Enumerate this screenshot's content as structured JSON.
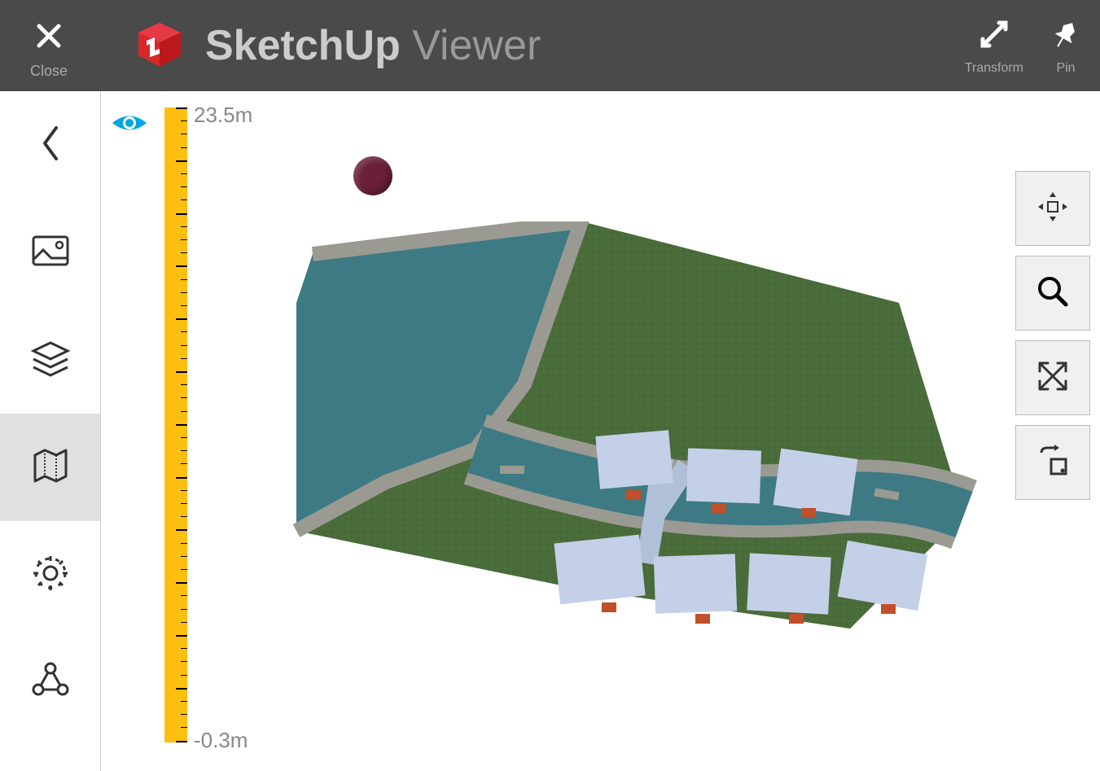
{
  "header": {
    "close_label": "Close",
    "app_name_bold": "SketchUp",
    "app_name_light": "Viewer",
    "transform_label": "Transform",
    "pin_label": "Pin"
  },
  "ruler": {
    "top_value": "23.5m",
    "bottom_value": "-0.3m"
  },
  "sidebar": {
    "active_index": 3
  },
  "icons": {
    "back": "chevron-left",
    "image": "image-icon",
    "layers": "layers-icon",
    "map": "map-icon",
    "settings": "gear-icon",
    "share": "share-nodes-icon"
  },
  "tools": {
    "move": "move-icon",
    "zoom": "search-icon",
    "fit": "expand-icon",
    "rotate": "rotate-icon"
  },
  "colors": {
    "header_bg": "#4a4a4a",
    "ruler": "#fdbf0f",
    "eye": "#0099d4",
    "marker": "#6a1f3a",
    "grass": "#4a6b3a",
    "water": "#3d7a84",
    "building": "#c4d0e8",
    "path": "#9a9a92"
  }
}
